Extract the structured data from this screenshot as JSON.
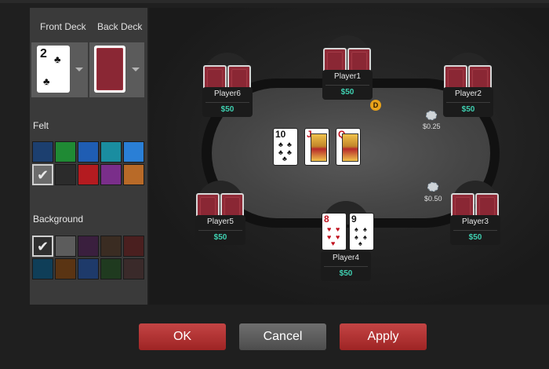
{
  "panel": {
    "front_deck_label": "Front Deck",
    "back_deck_label": "Back Deck",
    "front_preview": {
      "rank": "2",
      "suit": "♣"
    },
    "felt_label": "Felt",
    "background_label": "Background",
    "felt_colors": [
      "#1c3f6f",
      "#1f8a34",
      "#1f5db3",
      "#1a8da0",
      "#2a7fd6",
      "#6b6b6b",
      "#2b2b2b",
      "#b41b20",
      "#7a2e8a",
      "#b86a28"
    ],
    "felt_selected_index": 5,
    "background_colors": [
      "#2f2f2f",
      "#5c5c5c",
      "#3a1f3e",
      "#3a2c22",
      "#4a1f1f",
      "#0f3e58",
      "#5a3413",
      "#1e3a6a",
      "#1f3a1f",
      "#3a2a2a"
    ],
    "background_selected_index": 0
  },
  "table": {
    "players": [
      {
        "id": "p1",
        "name": "Player1",
        "stack": "$50"
      },
      {
        "id": "p2",
        "name": "Player2",
        "stack": "$50"
      },
      {
        "id": "p3",
        "name": "Player3",
        "stack": "$50"
      },
      {
        "id": "p4",
        "name": "Player4",
        "stack": "$50"
      },
      {
        "id": "p5",
        "name": "Player5",
        "stack": "$50"
      },
      {
        "id": "p6",
        "name": "Player6",
        "stack": "$50"
      }
    ],
    "board": [
      {
        "rank": "10",
        "suit": "♣",
        "color": "black"
      },
      {
        "rank": "J",
        "suit": "♦",
        "color": "red"
      },
      {
        "rank": "Q",
        "suit": "♥",
        "color": "red"
      }
    ],
    "hero_cards": [
      {
        "rank": "8",
        "suit": "♥",
        "color": "red"
      },
      {
        "rank": "9",
        "suit": "♠",
        "color": "black"
      }
    ],
    "dealer_button": "D",
    "small_blind": "$0.25",
    "big_blind": "$0.50"
  },
  "buttons": {
    "ok": "OK",
    "cancel": "Cancel",
    "apply": "Apply"
  }
}
